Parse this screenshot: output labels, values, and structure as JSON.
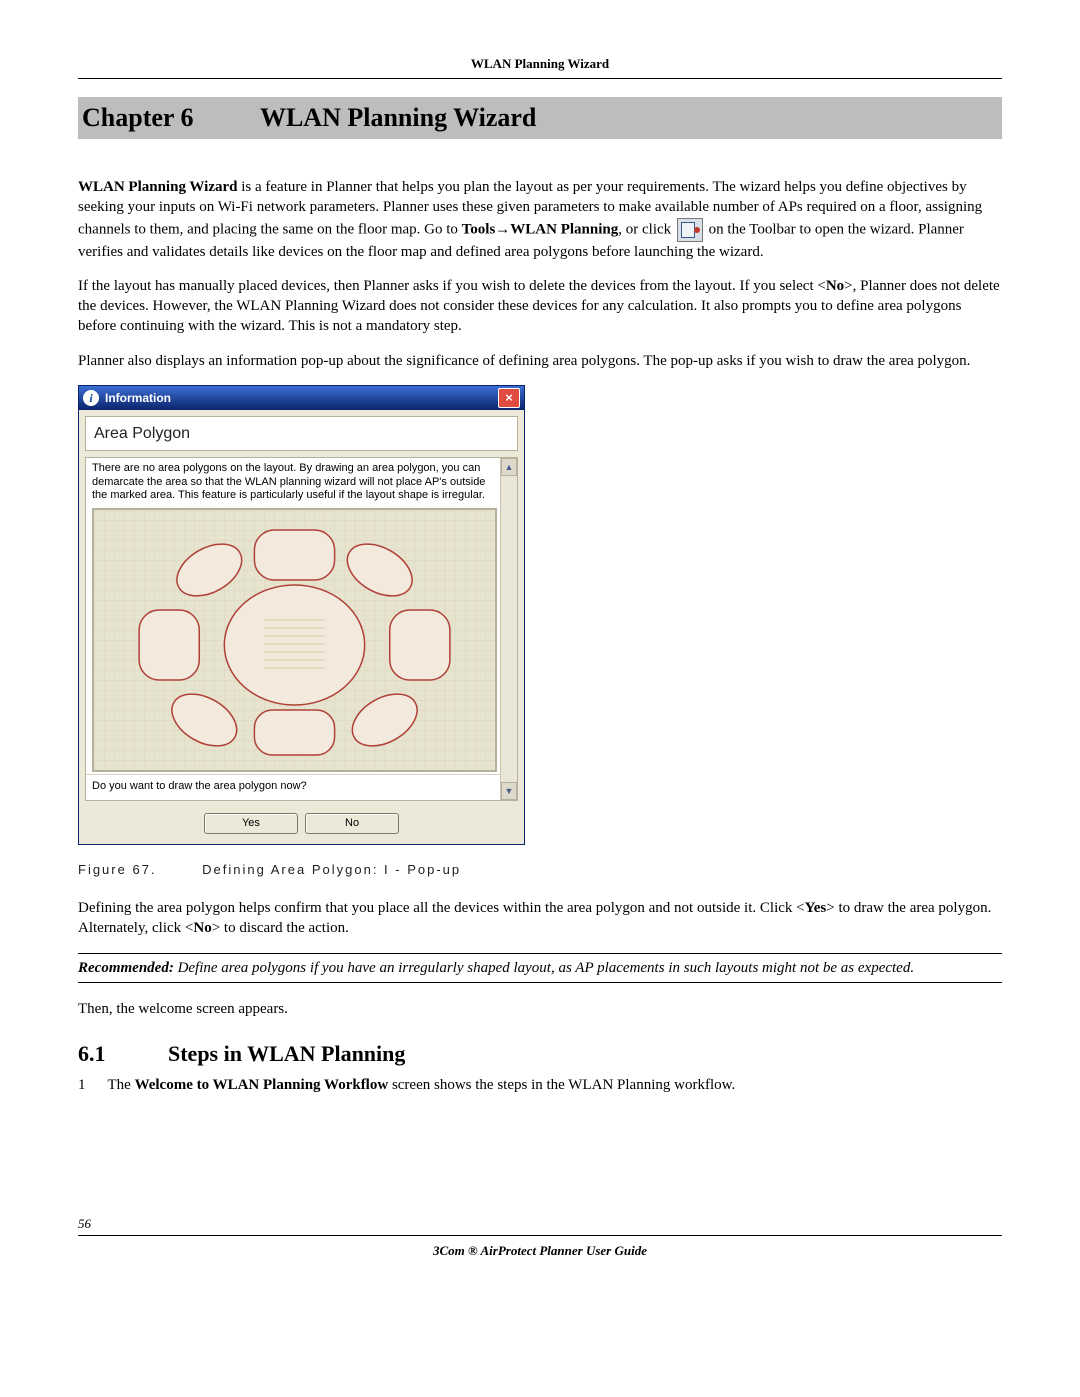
{
  "header": {
    "running_head": "WLAN Planning Wizard"
  },
  "chapter": {
    "num": "Chapter 6",
    "title": "WLAN Planning Wizard"
  },
  "para": {
    "p1_bold": "WLAN Planning Wizard",
    "p1_rest": " is a feature in Planner that helps you plan the layout as per your requirements. The wizard helps you define objectives by seeking your inputs on Wi-Fi network parameters. Planner uses these given parameters to make available number of APs required on a floor, assigning channels to them, and placing the same on the floor map. Go to ",
    "tools": "Tools",
    "arrow": "→",
    "wlanp": "WLAN Planning",
    "p1_afterpath": ", or click ",
    "p1_aftericon": " on the Toolbar to open the wizard. Planner verifies and validates details like devices on the floor map and defined area polygons before launching the wizard.",
    "p2_a": "If the layout has manually placed devices, then Planner asks if you wish to delete the devices from the layout. If you select <",
    "p2_no": "No",
    "p2_b": ">, Planner does not delete the devices. However, the WLAN Planning Wizard does not consider these devices for any calculation. It also prompts you to define area polygons before continuing with the wizard. This is not a mandatory step.",
    "p3": "Planner also displays an information pop-up about the significance of defining area polygons. The pop-up asks if you wish to draw the area polygon."
  },
  "dialog": {
    "title": "Information",
    "subtitle": "Area Polygon",
    "body": "There are no area polygons on the layout. By drawing an area polygon, you can demarcate the area so that the WLAN planning wizard will not place AP's outside the marked area. This feature is particularly useful if the layout shape is irregular.",
    "question": "Do you want to draw the area polygon now?",
    "yes": "Yes",
    "no": "No"
  },
  "figure": {
    "label": "Figure 67.",
    "caption": "Defining Area Polygon: I - Pop-up"
  },
  "para2": {
    "p4_a": "Defining the area polygon helps confirm that you place all the devices within the area polygon and not outside it. Click <",
    "p4_yes": "Yes",
    "p4_b": "> to draw the area polygon. Alternately, click <",
    "p4_no": "No",
    "p4_c": "> to discard the action.",
    "rec_label": "Recommended:",
    "rec_text": " Define area polygons if you have an irregularly shaped layout, as AP placements in such layouts might not be as expected.",
    "p5": "Then, the welcome screen appears."
  },
  "section": {
    "num": "6.1",
    "title": "Steps in WLAN Planning",
    "step1_num": "1",
    "step1_a": "The ",
    "step1_b": "Welcome to WLAN Planning Workflow",
    "step1_c": " screen shows the steps in the WLAN Planning workflow."
  },
  "footer": {
    "page": "56",
    "title": "3Com ® AirProtect Planner User Guide"
  }
}
